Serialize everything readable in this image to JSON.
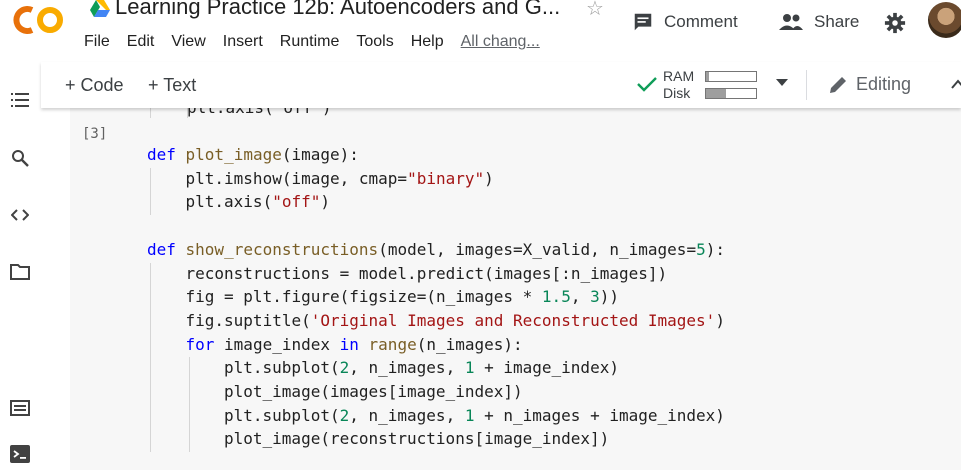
{
  "header": {
    "logo_text": "CO",
    "title": "Learning Practice 12b: Autoencoders and G...",
    "menu": [
      "File",
      "Edit",
      "View",
      "Insert",
      "Runtime",
      "Tools",
      "Help"
    ],
    "all_changes": "All chang...",
    "comment_label": "Comment",
    "share_label": "Share"
  },
  "toolbar": {
    "add_code": "+ Code",
    "add_text": "+ Text",
    "ram_label": "RAM",
    "disk_label": "Disk",
    "ram_usage": 0.06,
    "disk_usage": 0.4,
    "editing_label": "Editing"
  },
  "cell": {
    "exec_count": "[3]",
    "prev_line": "plt.axis(\"off\")",
    "lines": [
      {
        "indent": 0,
        "tokens": [
          [
            "kw",
            "def "
          ],
          [
            "fn",
            "plot_image"
          ],
          [
            "",
            "(image):"
          ]
        ]
      },
      {
        "indent": 1,
        "tokens": [
          [
            "",
            "plt.imshow(image, cmap="
          ],
          [
            "str",
            "\"binary\""
          ],
          [
            "",
            ")"
          ]
        ]
      },
      {
        "indent": 1,
        "tokens": [
          [
            "",
            "plt.axis("
          ],
          [
            "str",
            "\"off\""
          ],
          [
            "",
            ")"
          ]
        ]
      },
      {
        "indent": 0,
        "tokens": []
      },
      {
        "indent": 0,
        "tokens": [
          [
            "kw",
            "def "
          ],
          [
            "fn",
            "show_reconstructions"
          ],
          [
            "",
            "(model, images=X_valid, n_images="
          ],
          [
            "num",
            "5"
          ],
          [
            "",
            "):"
          ]
        ]
      },
      {
        "indent": 1,
        "tokens": [
          [
            "",
            "reconstructions = model.predict(images[:n_images])"
          ]
        ]
      },
      {
        "indent": 1,
        "tokens": [
          [
            "",
            "fig = plt.figure(figsize=(n_images * "
          ],
          [
            "num",
            "1.5"
          ],
          [
            "",
            ", "
          ],
          [
            "num",
            "3"
          ],
          [
            "",
            "))"
          ]
        ]
      },
      {
        "indent": 1,
        "tokens": [
          [
            "",
            "fig.suptitle("
          ],
          [
            "str",
            "'Original Images and Reconstructed Images'"
          ],
          [
            "",
            ")"
          ]
        ]
      },
      {
        "indent": 1,
        "tokens": [
          [
            "kw",
            "for"
          ],
          [
            "",
            " image_index "
          ],
          [
            "kw",
            "in"
          ],
          [
            "bi",
            " range"
          ],
          [
            "",
            "(n_images):"
          ]
        ]
      },
      {
        "indent": 2,
        "tokens": [
          [
            "",
            "plt.subplot("
          ],
          [
            "num",
            "2"
          ],
          [
            "",
            ", n_images, "
          ],
          [
            "num",
            "1"
          ],
          [
            "",
            " + image_index)"
          ]
        ]
      },
      {
        "indent": 2,
        "tokens": [
          [
            "",
            "plot_image(images[image_index])"
          ]
        ]
      },
      {
        "indent": 2,
        "tokens": [
          [
            "",
            "plt.subplot("
          ],
          [
            "num",
            "2"
          ],
          [
            "",
            ", n_images, "
          ],
          [
            "num",
            "1"
          ],
          [
            "",
            " + n_images + image_index)"
          ]
        ]
      },
      {
        "indent": 2,
        "tokens": [
          [
            "",
            "plot_image(reconstructions[image_index])"
          ]
        ]
      }
    ]
  },
  "colors": {
    "logo_orange": "#f9ab00",
    "logo_dark_orange": "#e8710a",
    "check_green": "#0f9d58"
  },
  "icons": {
    "rail": [
      "table-of-contents-icon",
      "search-icon",
      "code-snippets-icon",
      "files-icon",
      "command-palette-icon",
      "terminal-icon"
    ]
  }
}
